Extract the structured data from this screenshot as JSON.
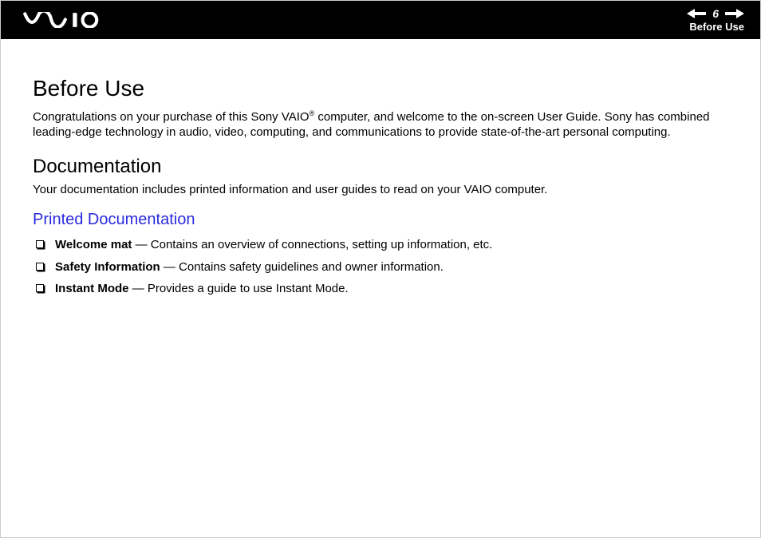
{
  "header": {
    "page_number": "6",
    "section": "Before Use"
  },
  "content": {
    "title": "Before Use",
    "intro_before_sup": "Congratulations on your purchase of this Sony VAIO",
    "intro_sup": "®",
    "intro_after_sup": " computer, and welcome to the on-screen User Guide. Sony has combined leading-edge technology in audio, video, computing, and communications to provide state-of-the-art personal computing.",
    "doc_heading": "Documentation",
    "doc_lead": "Your documentation includes printed information and user guides to read on your VAIO computer.",
    "printed_heading": "Printed Documentation",
    "items": [
      {
        "name": "Welcome mat",
        "desc": " — Contains an overview of connections, setting up information, etc."
      },
      {
        "name": "Safety Information",
        "desc": " — Contains safety guidelines and owner information."
      },
      {
        "name": "Instant Mode",
        "desc": " — Provides a guide to use Instant Mode."
      }
    ]
  }
}
